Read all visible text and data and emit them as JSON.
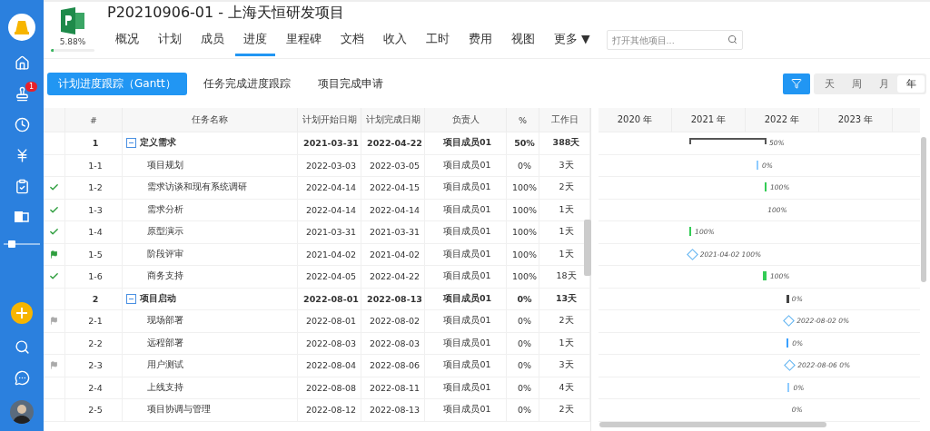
{
  "project": {
    "title": "P20210906-01 - 上海天恒研发项目",
    "progress_text": "5.88%",
    "level": 0.0588
  },
  "sidebar": {
    "badge": "1"
  },
  "nav_tabs": [
    {
      "label": "概况",
      "selected": false
    },
    {
      "label": "计划",
      "selected": false
    },
    {
      "label": "成员",
      "selected": false
    },
    {
      "label": "进度",
      "selected": true
    },
    {
      "label": "里程碑",
      "selected": false
    },
    {
      "label": "文档",
      "selected": false
    },
    {
      "label": "收入",
      "selected": false
    },
    {
      "label": "工时",
      "selected": false
    },
    {
      "label": "费用",
      "selected": false
    },
    {
      "label": "视图",
      "selected": false
    },
    {
      "label": "更多",
      "selected": false,
      "caret": "▼"
    }
  ],
  "search": {
    "placeholder": "打开其他项目..."
  },
  "sub_tabs": [
    {
      "label": "计划进度跟踪（Gantt）",
      "selected": true
    },
    {
      "label": "任务完成进度跟踪",
      "selected": false
    },
    {
      "label": "项目完成申请",
      "selected": false
    }
  ],
  "scale_options": [
    {
      "label": "天",
      "selected": false
    },
    {
      "label": "周",
      "selected": false
    },
    {
      "label": "月",
      "selected": false
    },
    {
      "label": "年",
      "selected": true
    }
  ],
  "table": {
    "columns": [
      "#",
      "任务名称",
      "计划开始日期",
      "计划完成日期",
      "负责人",
      "%",
      "工作日"
    ],
    "rows": [
      {
        "done": false,
        "flagged": false,
        "index": "1",
        "name": "定义需求",
        "start": "2021-03-31",
        "end": "2022-04-22",
        "owner": "项目成员01",
        "percent": "50%",
        "days": "388天",
        "expanded": true,
        "bar": {
          "kind": "summary",
          "label": "50%"
        },
        "children": [
          {
            "done": false,
            "flagged": false,
            "index": "1-1",
            "name": "项目规划",
            "start": "2022-03-03",
            "end": "2022-03-05",
            "owner": "项目成员01",
            "percent": "0%",
            "days": "3天",
            "bar": {
              "kind": "task",
              "color": "#8ecbff",
              "label": "0%"
            }
          },
          {
            "done": true,
            "flagged": false,
            "index": "1-2",
            "name": "需求访谈和现有系统调研",
            "start": "2022-04-14",
            "end": "2022-04-15",
            "owner": "项目成员01",
            "percent": "100%",
            "days": "2天",
            "bar": {
              "kind": "task",
              "color": "#33cc55",
              "label": "100%"
            }
          },
          {
            "done": true,
            "flagged": false,
            "index": "1-3",
            "name": "需求分析",
            "start": "2022-04-14",
            "end": "2022-04-14",
            "owner": "项目成员01",
            "percent": "100%",
            "days": "1天",
            "bar": {
              "kind": "none",
              "label": "100%"
            }
          },
          {
            "done": true,
            "flagged": false,
            "index": "1-4",
            "name": "原型演示",
            "start": "2021-03-31",
            "end": "2021-03-31",
            "owner": "项目成员01",
            "percent": "100%",
            "days": "1天",
            "bar": {
              "kind": "task",
              "color": "#33cc55",
              "label": "100%"
            }
          },
          {
            "done": false,
            "flagged": true,
            "color": "#2e9e3e",
            "index": "1-5",
            "name": "阶段评审",
            "start": "2021-04-02",
            "end": "2021-04-02",
            "owner": "项目成员01",
            "percent": "100%",
            "days": "1天",
            "bar": {
              "kind": "milestone",
              "label": "2021-04-02 100%"
            }
          },
          {
            "done": true,
            "flagged": false,
            "index": "1-6",
            "name": "商务支持",
            "start": "2022-04-05",
            "end": "2022-04-22",
            "owner": "项目成员01",
            "percent": "100%",
            "days": "18天",
            "bar": {
              "kind": "task",
              "color": "#33cc55",
              "label": "100%"
            }
          }
        ]
      },
      {
        "done": false,
        "flagged": false,
        "index": "2",
        "name": "项目启动",
        "start": "2022-08-01",
        "end": "2022-08-13",
        "owner": "项目成员01",
        "percent": "0%",
        "days": "13天",
        "expanded": true,
        "bar": {
          "kind": "block",
          "label": "0%"
        },
        "children": [
          {
            "done": false,
            "flagged": true,
            "color": "#aaaaaa",
            "index": "2-1",
            "name": "现场部署",
            "start": "2022-08-01",
            "end": "2022-08-02",
            "owner": "项目成员01",
            "percent": "0%",
            "days": "2天",
            "bar": {
              "kind": "milestone",
              "label": "2022-08-02 0%"
            }
          },
          {
            "done": false,
            "flagged": false,
            "index": "2-2",
            "name": "远程部署",
            "start": "2022-08-03",
            "end": "2022-08-03",
            "owner": "项目成员01",
            "percent": "0%",
            "days": "1天",
            "bar": {
              "kind": "task",
              "color": "#3aa0ff",
              "label": "0%"
            }
          },
          {
            "done": false,
            "flagged": true,
            "color": "#aaaaaa",
            "index": "2-3",
            "name": "用户测试",
            "start": "2022-08-04",
            "end": "2022-08-06",
            "owner": "项目成员01",
            "percent": "0%",
            "days": "3天",
            "bar": {
              "kind": "milestone",
              "label": "2022-08-06 0%"
            }
          },
          {
            "done": false,
            "flagged": false,
            "index": "2-4",
            "name": "上线支持",
            "start": "2022-08-08",
            "end": "2022-08-11",
            "owner": "项目成员01",
            "percent": "0%",
            "days": "4天",
            "bar": {
              "kind": "task",
              "color": "#8ecbff",
              "label": "0%"
            }
          },
          {
            "done": false,
            "flagged": false,
            "index": "2-5",
            "name": "项目协调与管理",
            "start": "2022-08-12",
            "end": "2022-08-13",
            "owner": "项目成员01",
            "percent": "0%",
            "days": "2天",
            "bar": {
              "kind": "none",
              "label": "0%"
            }
          }
        ]
      }
    ]
  },
  "gantt": {
    "years": [
      "2020 年",
      "2021 年",
      "2022 年",
      "2023 年"
    ]
  }
}
